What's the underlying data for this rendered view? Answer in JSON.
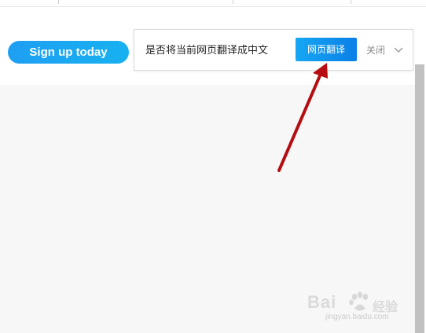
{
  "header": {
    "signup_label": "Sign up today"
  },
  "translate_bar": {
    "prompt": "是否将当前网页翻译成中文",
    "translate_label": "网页翻译",
    "close_label": "关闭"
  },
  "watermark": {
    "logo_text": "Bai",
    "logo_suffix": "经验",
    "url": "jingyan.baidu.com"
  },
  "colors": {
    "signup_button": "#1fa6f1",
    "translate_button": "#0f8fed",
    "annotation_arrow": "#b50d12",
    "content_bg": "#f7f7f7"
  },
  "icons": {
    "dropdown": "chevron-down-icon",
    "annotation": "red-arrow-annotation",
    "watermark_paw": "baidu-paw-icon"
  }
}
